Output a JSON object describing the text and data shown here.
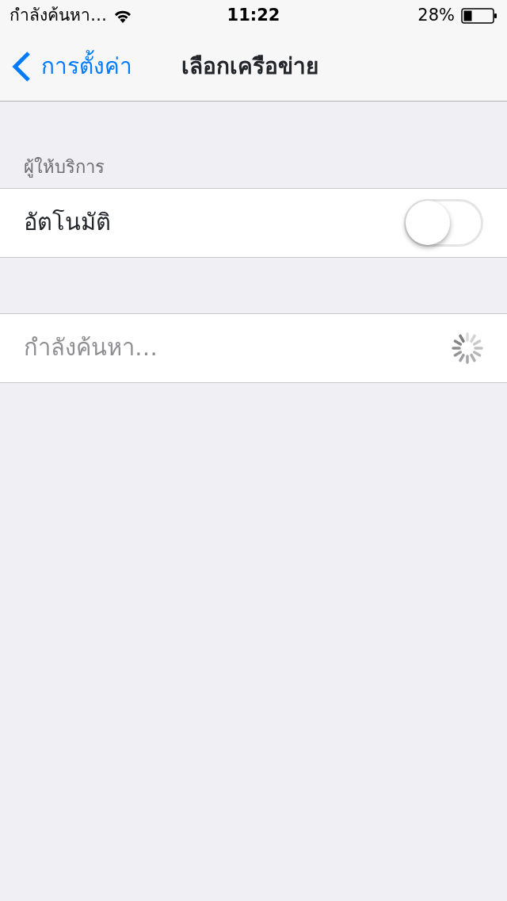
{
  "status_bar": {
    "carrier": "กำลังค้นหา…",
    "time": "11:22",
    "battery": "28%"
  },
  "nav_bar": {
    "back_label": "การตั้งค่า",
    "title": "เลือกเครือข่าย"
  },
  "sections": [
    {
      "header": "ผู้ให้บริการ",
      "rows": [
        {
          "kind": "toggle",
          "label": "อัตโนมัติ",
          "on": false
        }
      ]
    },
    {
      "rows": [
        {
          "kind": "searching",
          "label": "กำลังค้นหา…"
        }
      ]
    }
  ]
}
